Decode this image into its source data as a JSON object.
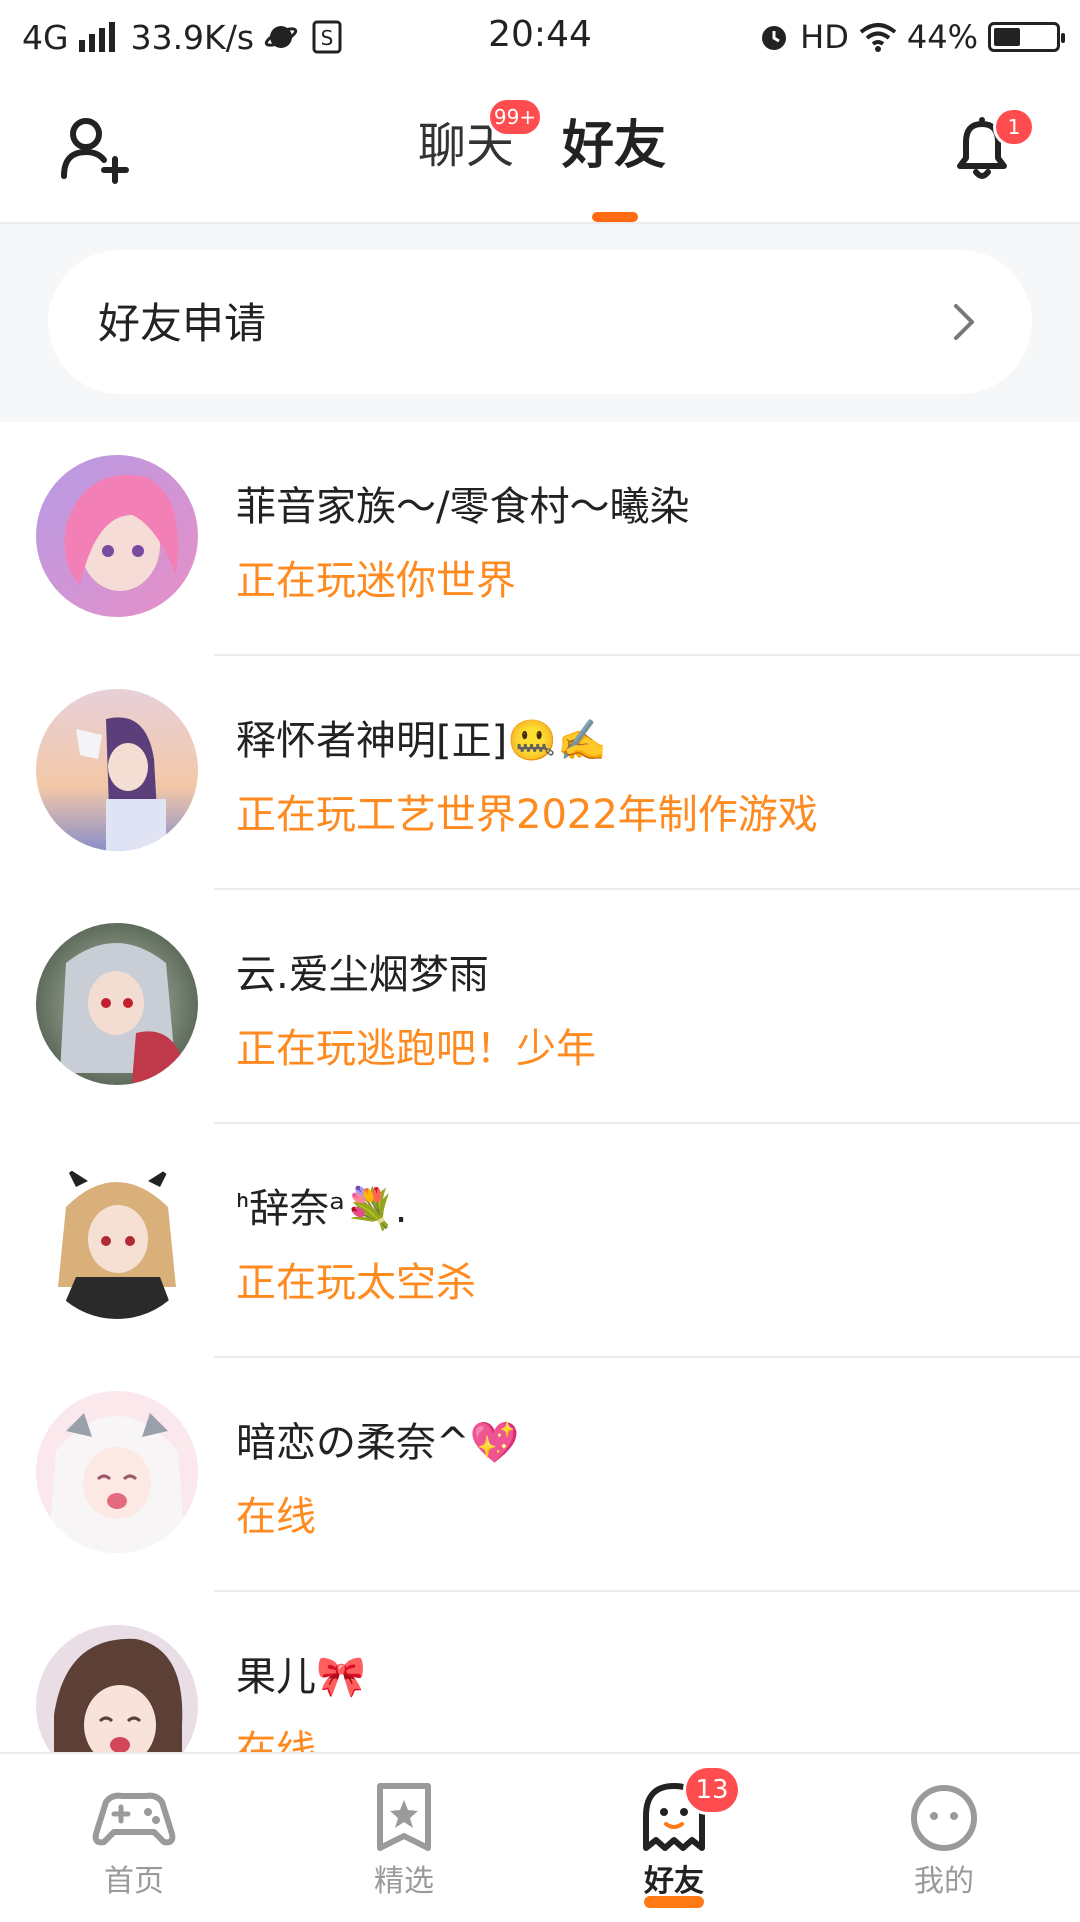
{
  "status_bar": {
    "network": "4G",
    "speed": "33.9K/s",
    "time": "20:44",
    "hd": "HD",
    "battery": "44%",
    "battery_level": 0.44
  },
  "header": {
    "tabs": [
      {
        "label": "聊天",
        "badge": "99+",
        "active": false
      },
      {
        "label": "好友",
        "active": true
      }
    ],
    "bell_badge": "1"
  },
  "requests": {
    "label": "好友申请"
  },
  "friends": [
    {
      "name": "菲音家族～/零食村～曦染",
      "status": "正在玩迷你世界",
      "avatar_colors": [
        "#e79ad0",
        "#b88ae0"
      ]
    },
    {
      "name": "释怀者神明[正]🤐✍️",
      "status": "正在玩工艺世界2022年制作游戏",
      "avatar_colors": [
        "#f0c7b0",
        "#6d5a9b"
      ]
    },
    {
      "name": "云.爱尘烟梦雨",
      "status": "正在玩逃跑吧！少年",
      "avatar_colors": [
        "#6f8f6f",
        "#c0394a"
      ]
    },
    {
      "name": "ᑋ辞奈ᵃ💐.",
      "status": "正在玩太空杀",
      "avatar_colors": [
        "#e3c08c",
        "#2b2b2b"
      ]
    },
    {
      "name": "暗恋の柔奈^💖",
      "status": "在线",
      "avatar_colors": [
        "#f6d6dc",
        "#f0f0f0"
      ]
    },
    {
      "name": "果儿🎀",
      "status": "在线",
      "avatar_colors": [
        "#5c4036",
        "#f3d3c9"
      ]
    }
  ],
  "bottom_nav": [
    {
      "label": "首页",
      "icon": "gamepad-icon",
      "active": false
    },
    {
      "label": "精选",
      "icon": "star-bookmark-icon",
      "active": false
    },
    {
      "label": "好友",
      "icon": "ghost-icon",
      "active": true,
      "badge": "13"
    },
    {
      "label": "我的",
      "icon": "smiley-face-icon",
      "active": false
    }
  ],
  "colors": {
    "accent": "#ff6a13",
    "status_text": "#ff8a1f",
    "badge": "#ff4d4f"
  }
}
